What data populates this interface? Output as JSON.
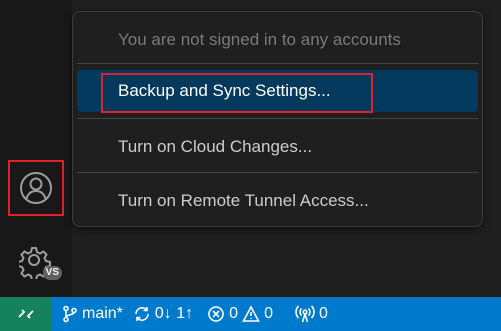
{
  "accounts_menu": {
    "items": [
      {
        "label": "You are not signed in to any accounts",
        "enabled": false
      },
      {
        "label": "Backup and Sync Settings...",
        "enabled": true,
        "selected": true
      },
      {
        "label": "Turn on Cloud Changes...",
        "enabled": true
      },
      {
        "label": "Turn on Remote Tunnel Access...",
        "enabled": true
      }
    ]
  },
  "activity_bar": {
    "accounts_icon": "account-icon",
    "manage_icon": "gear-icon",
    "manage_badge": "VS"
  },
  "status_bar": {
    "remote_icon": "remote-icon",
    "branch": "main*",
    "sync": "0↓ 1↑",
    "errors": "0",
    "warnings": "0",
    "ports": "0"
  },
  "colors": {
    "status_bar": "#007acc",
    "remote": "#16825d",
    "selected_item": "#04395e",
    "highlight": "#e0202a"
  }
}
